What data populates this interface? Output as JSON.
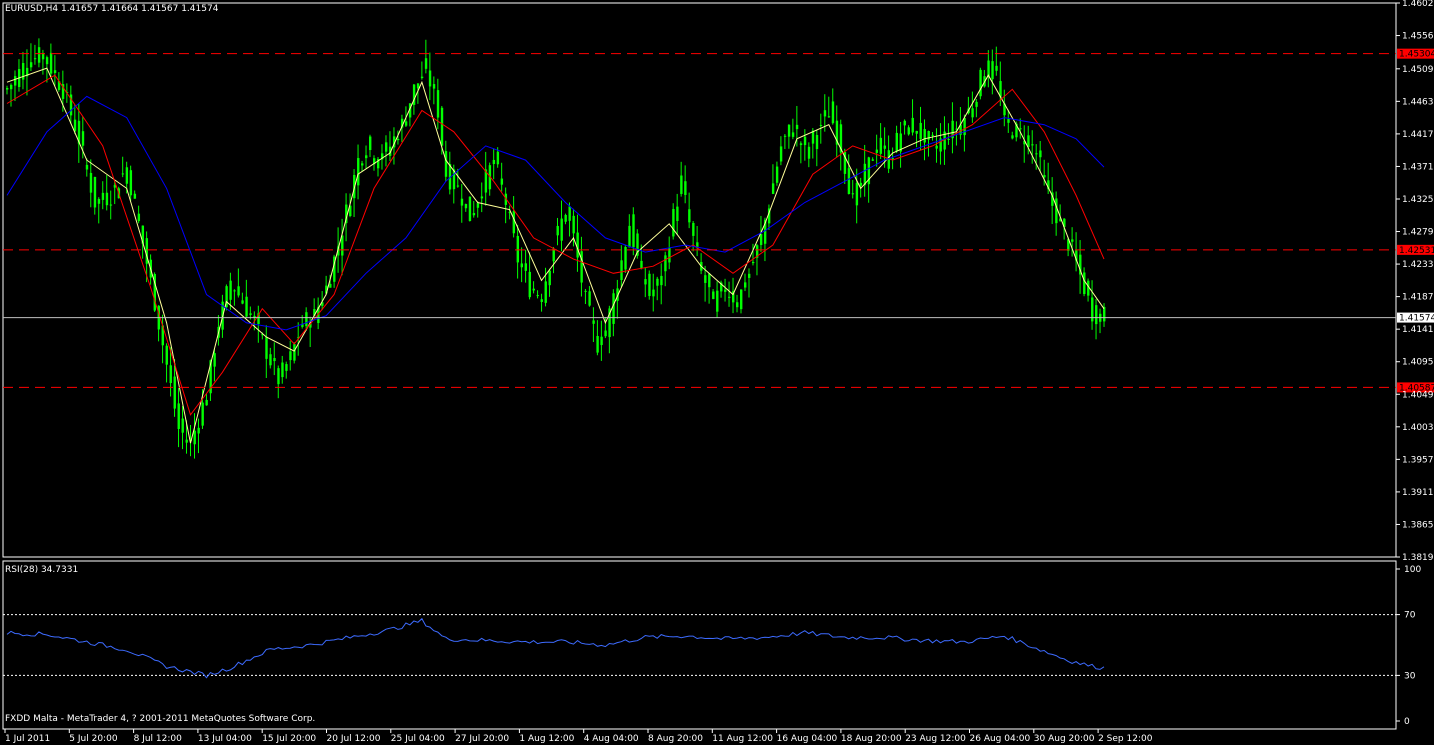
{
  "header": {
    "main_title": "EURUSD,H4  1.41657 1.41664 1.41567 1.41574",
    "rsi_title": "RSI(28) 34.7331",
    "footer": "FXDD Malta - MetaTrader 4, ? 2001-2011 MetaQuotes Software Corp."
  },
  "colors": {
    "background": "#000000",
    "frame": "#ffffff",
    "candle": "#00ff00",
    "ma_fast": "#ffff99",
    "ma_mid": "#ff0000",
    "ma_slow": "#0000ff",
    "levels": "#ff0000",
    "rsi_line": "#3d6bff",
    "rsi_levels": "#ffffff",
    "price_line": "#c0c0c0"
  },
  "chart_data": [
    {
      "type": "candlestick",
      "symbol": "EURUSD",
      "timeframe": "H4",
      "ylim": [
        1.3819,
        1.4602
      ],
      "y_ticks": [
        "1.46020",
        "1.45560",
        "1.45090",
        "1.44630",
        "1.44170",
        "1.43710",
        "1.43250",
        "1.42790",
        "1.42330",
        "1.41870",
        "1.41410",
        "1.40950",
        "1.40490",
        "1.40030",
        "1.39570",
        "1.39110",
        "1.38650",
        "1.38190"
      ],
      "x_ticks": [
        "1 Jul 2011",
        "5 Jul 20:00",
        "8 Jul 12:00",
        "13 Jul 04:00",
        "15 Jul 20:00",
        "20 Jul 12:00",
        "25 Jul 04:00",
        "27 Jul 20:00",
        "1 Aug 12:00",
        "4 Aug 04:00",
        "8 Aug 20:00",
        "11 Aug 12:00",
        "16 Aug 04:00",
        "18 Aug 20:00",
        "23 Aug 12:00",
        "26 Aug 04:00",
        "30 Aug 20:00",
        "2 Sep 12:00"
      ],
      "current_price": {
        "value": 1.41574,
        "label": "1.41574"
      },
      "horizontal_levels": [
        {
          "value": 1.45304,
          "label": "1.45304"
        },
        {
          "value": 1.42531,
          "label": "1.42531"
        },
        {
          "value": 1.40587,
          "label": "1.40587"
        }
      ],
      "close_path": [
        [
          0,
          1.448
        ],
        [
          5,
          1.452
        ],
        [
          9,
          1.453
        ],
        [
          14,
          1.448
        ],
        [
          18,
          1.441
        ],
        [
          22,
          1.432
        ],
        [
          26,
          1.433
        ],
        [
          30,
          1.437
        ],
        [
          33,
          1.429
        ],
        [
          37,
          1.418
        ],
        [
          40,
          1.409
        ],
        [
          43,
          1.4
        ],
        [
          46,
          1.398
        ],
        [
          50,
          1.405
        ],
        [
          53,
          1.415
        ],
        [
          56,
          1.421
        ],
        [
          59,
          1.418
        ],
        [
          62,
          1.415
        ],
        [
          65,
          1.411
        ],
        [
          68,
          1.407
        ],
        [
          71,
          1.41
        ],
        [
          74,
          1.415
        ],
        [
          77,
          1.416
        ],
        [
          80,
          1.42
        ],
        [
          83,
          1.426
        ],
        [
          86,
          1.433
        ],
        [
          88,
          1.438
        ],
        [
          90,
          1.44
        ],
        [
          93,
          1.438
        ],
        [
          96,
          1.44
        ],
        [
          99,
          1.443
        ],
        [
          102,
          1.448
        ],
        [
          105,
          1.451
        ],
        [
          108,
          1.445
        ],
        [
          110,
          1.436
        ],
        [
          113,
          1.434
        ],
        [
          116,
          1.43
        ],
        [
          119,
          1.434
        ],
        [
          122,
          1.438
        ],
        [
          125,
          1.432
        ],
        [
          128,
          1.424
        ],
        [
          131,
          1.42
        ],
        [
          134,
          1.419
        ],
        [
          137,
          1.426
        ],
        [
          140,
          1.431
        ],
        [
          142,
          1.427
        ],
        [
          145,
          1.418
        ],
        [
          148,
          1.412
        ],
        [
          150,
          1.414
        ],
        [
          153,
          1.421
        ],
        [
          156,
          1.429
        ],
        [
          158,
          1.424
        ],
        [
          161,
          1.419
        ],
        [
          164,
          1.421
        ],
        [
          167,
          1.43
        ],
        [
          169,
          1.435
        ],
        [
          171,
          1.429
        ],
        [
          174,
          1.422
        ],
        [
          177,
          1.418
        ],
        [
          180,
          1.42
        ],
        [
          183,
          1.418
        ],
        [
          186,
          1.422
        ],
        [
          189,
          1.427
        ],
        [
          191,
          1.432
        ],
        [
          194,
          1.44
        ],
        [
          197,
          1.443
        ],
        [
          200,
          1.439
        ],
        [
          203,
          1.442
        ],
        [
          206,
          1.445
        ],
        [
          209,
          1.44
        ],
        [
          212,
          1.432
        ],
        [
          215,
          1.436
        ],
        [
          218,
          1.44
        ],
        [
          221,
          1.438
        ],
        [
          224,
          1.442
        ],
        [
          227,
          1.443
        ],
        [
          230,
          1.441
        ],
        [
          233,
          1.44
        ],
        [
          236,
          1.442
        ],
        [
          239,
          1.443
        ],
        [
          242,
          1.446
        ],
        [
          245,
          1.451
        ],
        [
          248,
          1.45
        ],
        [
          250,
          1.443
        ],
        [
          253,
          1.442
        ],
        [
          256,
          1.441
        ],
        [
          258,
          1.439
        ],
        [
          261,
          1.433
        ],
        [
          264,
          1.429
        ],
        [
          267,
          1.425
        ],
        [
          270,
          1.42
        ],
        [
          272,
          1.4165
        ],
        [
          275,
          1.41574
        ]
      ],
      "moving_averages": [
        {
          "color": "ma_fast",
          "points": [
            [
              0,
              1.449
            ],
            [
              10,
              1.451
            ],
            [
              20,
              1.438
            ],
            [
              30,
              1.434
            ],
            [
              40,
              1.415
            ],
            [
              46,
              1.398
            ],
            [
              55,
              1.418
            ],
            [
              65,
              1.413
            ],
            [
              72,
              1.411
            ],
            [
              80,
              1.419
            ],
            [
              88,
              1.436
            ],
            [
              96,
              1.439
            ],
            [
              104,
              1.449
            ],
            [
              110,
              1.438
            ],
            [
              118,
              1.432
            ],
            [
              126,
              1.431
            ],
            [
              134,
              1.421
            ],
            [
              142,
              1.427
            ],
            [
              150,
              1.415
            ],
            [
              158,
              1.425
            ],
            [
              166,
              1.429
            ],
            [
              174,
              1.423
            ],
            [
              182,
              1.419
            ],
            [
              190,
              1.429
            ],
            [
              198,
              1.441
            ],
            [
              206,
              1.443
            ],
            [
              214,
              1.434
            ],
            [
              222,
              1.439
            ],
            [
              230,
              1.441
            ],
            [
              238,
              1.442
            ],
            [
              246,
              1.45
            ],
            [
              254,
              1.442
            ],
            [
              262,
              1.433
            ],
            [
              270,
              1.421
            ],
            [
              275,
              1.417
            ]
          ]
        },
        {
          "color": "ma_mid",
          "points": [
            [
              0,
              1.446
            ],
            [
              12,
              1.45
            ],
            [
              24,
              1.44
            ],
            [
              36,
              1.42
            ],
            [
              46,
              1.402
            ],
            [
              54,
              1.408
            ],
            [
              64,
              1.417
            ],
            [
              72,
              1.412
            ],
            [
              82,
              1.419
            ],
            [
              92,
              1.434
            ],
            [
              104,
              1.445
            ],
            [
              112,
              1.442
            ],
            [
              122,
              1.435
            ],
            [
              132,
              1.427
            ],
            [
              142,
              1.424
            ],
            [
              152,
              1.422
            ],
            [
              162,
              1.423
            ],
            [
              172,
              1.426
            ],
            [
              182,
              1.422
            ],
            [
              192,
              1.426
            ],
            [
              202,
              1.436
            ],
            [
              212,
              1.44
            ],
            [
              222,
              1.438
            ],
            [
              232,
              1.44
            ],
            [
              242,
              1.443
            ],
            [
              252,
              1.448
            ],
            [
              260,
              1.442
            ],
            [
              268,
              1.433
            ],
            [
              275,
              1.424
            ]
          ]
        },
        {
          "color": "ma_slow",
          "points": [
            [
              0,
              1.433
            ],
            [
              10,
              1.442
            ],
            [
              20,
              1.447
            ],
            [
              30,
              1.444
            ],
            [
              40,
              1.434
            ],
            [
              50,
              1.419
            ],
            [
              60,
              1.415
            ],
            [
              70,
              1.414
            ],
            [
              80,
              1.416
            ],
            [
              90,
              1.422
            ],
            [
              100,
              1.427
            ],
            [
              110,
              1.435
            ],
            [
              120,
              1.44
            ],
            [
              130,
              1.438
            ],
            [
              140,
              1.432
            ],
            [
              150,
              1.427
            ],
            [
              160,
              1.425
            ],
            [
              170,
              1.426
            ],
            [
              180,
              1.425
            ],
            [
              190,
              1.428
            ],
            [
              200,
              1.432
            ],
            [
              210,
              1.435
            ],
            [
              220,
              1.438
            ],
            [
              230,
              1.44
            ],
            [
              240,
              1.442
            ],
            [
              250,
              1.444
            ],
            [
              260,
              1.443
            ],
            [
              268,
              1.441
            ],
            [
              275,
              1.437
            ]
          ]
        }
      ]
    },
    {
      "type": "line",
      "name": "RSI(28)",
      "ylim": [
        0,
        100
      ],
      "levels": [
        70,
        30
      ],
      "y_ticks": [
        "100",
        "70",
        "30",
        "0"
      ],
      "values": [
        [
          0,
          58
        ],
        [
          10,
          57
        ],
        [
          20,
          52
        ],
        [
          30,
          47
        ],
        [
          40,
          36
        ],
        [
          50,
          30
        ],
        [
          56,
          35
        ],
        [
          66,
          47
        ],
        [
          76,
          50
        ],
        [
          86,
          55
        ],
        [
          96,
          60
        ],
        [
          104,
          66
        ],
        [
          110,
          54
        ],
        [
          120,
          53
        ],
        [
          130,
          52
        ],
        [
          140,
          52
        ],
        [
          150,
          50
        ],
        [
          160,
          55
        ],
        [
          170,
          56
        ],
        [
          180,
          54
        ],
        [
          190,
          55
        ],
        [
          200,
          58
        ],
        [
          210,
          55
        ],
        [
          220,
          55
        ],
        [
          230,
          53
        ],
        [
          240,
          52
        ],
        [
          250,
          56
        ],
        [
          258,
          48
        ],
        [
          266,
          40
        ],
        [
          272,
          36
        ],
        [
          275,
          35
        ]
      ]
    }
  ]
}
